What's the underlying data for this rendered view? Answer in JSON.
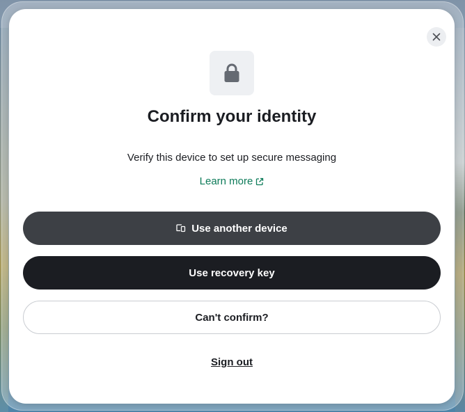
{
  "dialog": {
    "close_icon": "close-icon",
    "lock_icon": "lock-icon",
    "title": "Confirm your identity",
    "subtitle": "Verify this device to set up secure messaging",
    "learn_more": {
      "label": "Learn more",
      "icon": "external-link-icon"
    },
    "buttons": {
      "use_another_device": {
        "label": "Use another device",
        "icon": "devices-icon"
      },
      "use_recovery_key": {
        "label": "Use recovery key"
      },
      "cant_confirm": {
        "label": "Can't confirm?"
      }
    },
    "sign_out": "Sign out"
  },
  "colors": {
    "accent_link": "#0d7b59",
    "primary_button": "#1b1d22",
    "secondary_button": "#3d4045",
    "text": "#1b1d22"
  }
}
